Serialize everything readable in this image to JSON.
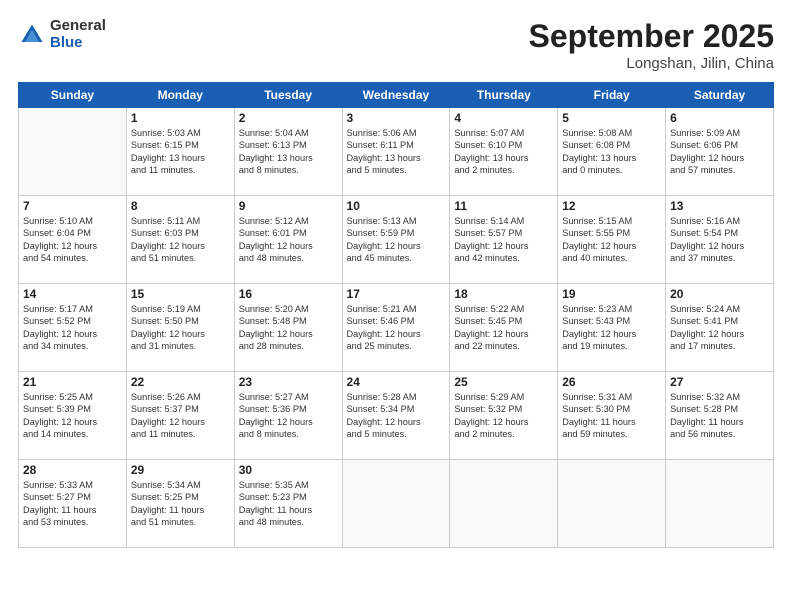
{
  "logo": {
    "general": "General",
    "blue": "Blue"
  },
  "title": {
    "month": "September 2025",
    "location": "Longshan, Jilin, China"
  },
  "headers": [
    "Sunday",
    "Monday",
    "Tuesday",
    "Wednesday",
    "Thursday",
    "Friday",
    "Saturday"
  ],
  "weeks": [
    [
      {
        "num": "",
        "info": ""
      },
      {
        "num": "1",
        "info": "Sunrise: 5:03 AM\nSunset: 6:15 PM\nDaylight: 13 hours\nand 11 minutes."
      },
      {
        "num": "2",
        "info": "Sunrise: 5:04 AM\nSunset: 6:13 PM\nDaylight: 13 hours\nand 8 minutes."
      },
      {
        "num": "3",
        "info": "Sunrise: 5:06 AM\nSunset: 6:11 PM\nDaylight: 13 hours\nand 5 minutes."
      },
      {
        "num": "4",
        "info": "Sunrise: 5:07 AM\nSunset: 6:10 PM\nDaylight: 13 hours\nand 2 minutes."
      },
      {
        "num": "5",
        "info": "Sunrise: 5:08 AM\nSunset: 6:08 PM\nDaylight: 13 hours\nand 0 minutes."
      },
      {
        "num": "6",
        "info": "Sunrise: 5:09 AM\nSunset: 6:06 PM\nDaylight: 12 hours\nand 57 minutes."
      }
    ],
    [
      {
        "num": "7",
        "info": "Sunrise: 5:10 AM\nSunset: 6:04 PM\nDaylight: 12 hours\nand 54 minutes."
      },
      {
        "num": "8",
        "info": "Sunrise: 5:11 AM\nSunset: 6:03 PM\nDaylight: 12 hours\nand 51 minutes."
      },
      {
        "num": "9",
        "info": "Sunrise: 5:12 AM\nSunset: 6:01 PM\nDaylight: 12 hours\nand 48 minutes."
      },
      {
        "num": "10",
        "info": "Sunrise: 5:13 AM\nSunset: 5:59 PM\nDaylight: 12 hours\nand 45 minutes."
      },
      {
        "num": "11",
        "info": "Sunrise: 5:14 AM\nSunset: 5:57 PM\nDaylight: 12 hours\nand 42 minutes."
      },
      {
        "num": "12",
        "info": "Sunrise: 5:15 AM\nSunset: 5:55 PM\nDaylight: 12 hours\nand 40 minutes."
      },
      {
        "num": "13",
        "info": "Sunrise: 5:16 AM\nSunset: 5:54 PM\nDaylight: 12 hours\nand 37 minutes."
      }
    ],
    [
      {
        "num": "14",
        "info": "Sunrise: 5:17 AM\nSunset: 5:52 PM\nDaylight: 12 hours\nand 34 minutes."
      },
      {
        "num": "15",
        "info": "Sunrise: 5:19 AM\nSunset: 5:50 PM\nDaylight: 12 hours\nand 31 minutes."
      },
      {
        "num": "16",
        "info": "Sunrise: 5:20 AM\nSunset: 5:48 PM\nDaylight: 12 hours\nand 28 minutes."
      },
      {
        "num": "17",
        "info": "Sunrise: 5:21 AM\nSunset: 5:46 PM\nDaylight: 12 hours\nand 25 minutes."
      },
      {
        "num": "18",
        "info": "Sunrise: 5:22 AM\nSunset: 5:45 PM\nDaylight: 12 hours\nand 22 minutes."
      },
      {
        "num": "19",
        "info": "Sunrise: 5:23 AM\nSunset: 5:43 PM\nDaylight: 12 hours\nand 19 minutes."
      },
      {
        "num": "20",
        "info": "Sunrise: 5:24 AM\nSunset: 5:41 PM\nDaylight: 12 hours\nand 17 minutes."
      }
    ],
    [
      {
        "num": "21",
        "info": "Sunrise: 5:25 AM\nSunset: 5:39 PM\nDaylight: 12 hours\nand 14 minutes."
      },
      {
        "num": "22",
        "info": "Sunrise: 5:26 AM\nSunset: 5:37 PM\nDaylight: 12 hours\nand 11 minutes."
      },
      {
        "num": "23",
        "info": "Sunrise: 5:27 AM\nSunset: 5:36 PM\nDaylight: 12 hours\nand 8 minutes."
      },
      {
        "num": "24",
        "info": "Sunrise: 5:28 AM\nSunset: 5:34 PM\nDaylight: 12 hours\nand 5 minutes."
      },
      {
        "num": "25",
        "info": "Sunrise: 5:29 AM\nSunset: 5:32 PM\nDaylight: 12 hours\nand 2 minutes."
      },
      {
        "num": "26",
        "info": "Sunrise: 5:31 AM\nSunset: 5:30 PM\nDaylight: 11 hours\nand 59 minutes."
      },
      {
        "num": "27",
        "info": "Sunrise: 5:32 AM\nSunset: 5:28 PM\nDaylight: 11 hours\nand 56 minutes."
      }
    ],
    [
      {
        "num": "28",
        "info": "Sunrise: 5:33 AM\nSunset: 5:27 PM\nDaylight: 11 hours\nand 53 minutes."
      },
      {
        "num": "29",
        "info": "Sunrise: 5:34 AM\nSunset: 5:25 PM\nDaylight: 11 hours\nand 51 minutes."
      },
      {
        "num": "30",
        "info": "Sunrise: 5:35 AM\nSunset: 5:23 PM\nDaylight: 11 hours\nand 48 minutes."
      },
      {
        "num": "",
        "info": ""
      },
      {
        "num": "",
        "info": ""
      },
      {
        "num": "",
        "info": ""
      },
      {
        "num": "",
        "info": ""
      }
    ]
  ]
}
